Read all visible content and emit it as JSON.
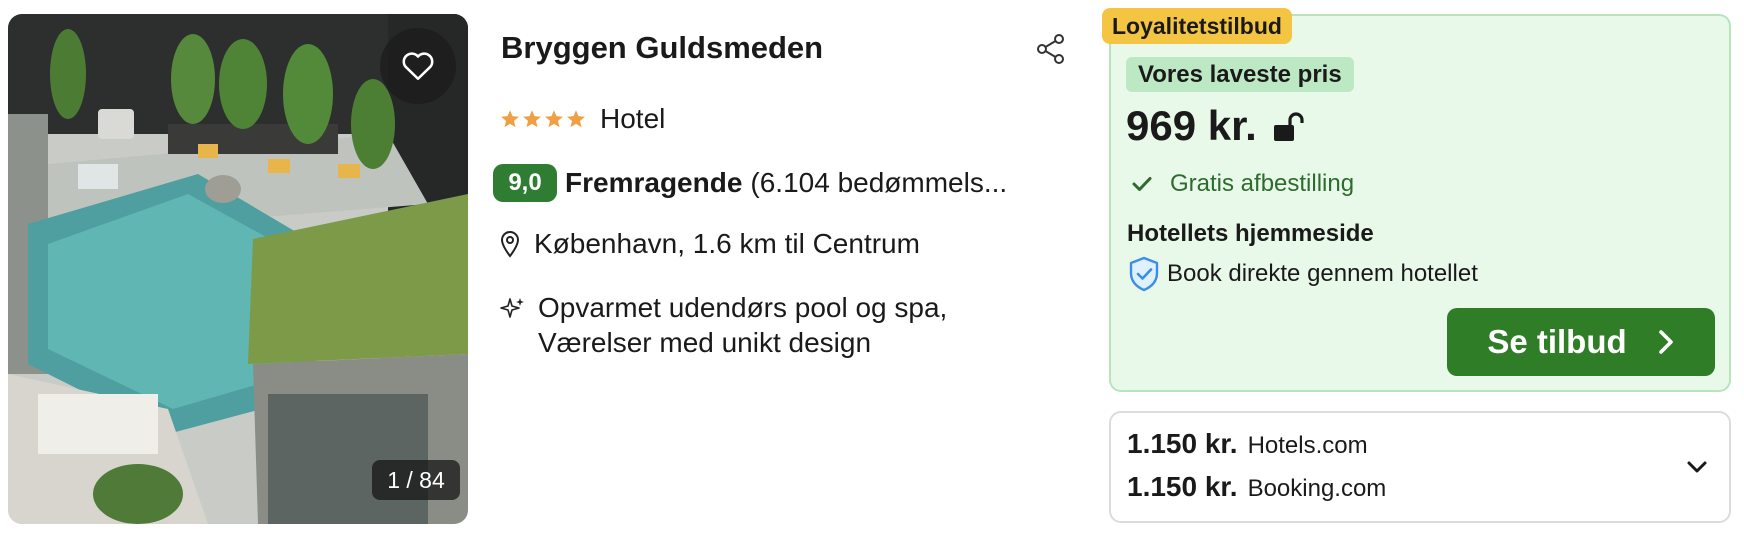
{
  "photo": {
    "counter": "1 / 84",
    "favorite_icon": "heart-outline-icon"
  },
  "hotel": {
    "name": "Bryggen Guldsmeden",
    "stars": 4,
    "star_color": "#f0a044",
    "type": "Hotel",
    "score": "9,0",
    "score_color": "#2e7d32",
    "score_label": "Fremragende",
    "review_count_text": "(6.104 bedømmels...",
    "location": "København, 1.6 km til Centrum",
    "amenities_line1": "Opvarmet udendørs pool og spa,",
    "amenities_line2": "Værelser med unikt design"
  },
  "deal": {
    "loyalty_tag": "Loyalitetstilbud",
    "lowest_tag": "Vores laveste pris",
    "price": "969 kr.",
    "free_cancellation": "Gratis afbestilling",
    "site_title": "Hotellets hjemmeside",
    "book_direct": "Book direkte gennem hotellet",
    "cta_label": "Se tilbud",
    "accent_color": "#2f7d26",
    "background_color": "#e9f9e9"
  },
  "other_offers": [
    {
      "price": "1.150 kr.",
      "site": "Hotels.com"
    },
    {
      "price": "1.150 kr.",
      "site": "Booking.com"
    }
  ]
}
